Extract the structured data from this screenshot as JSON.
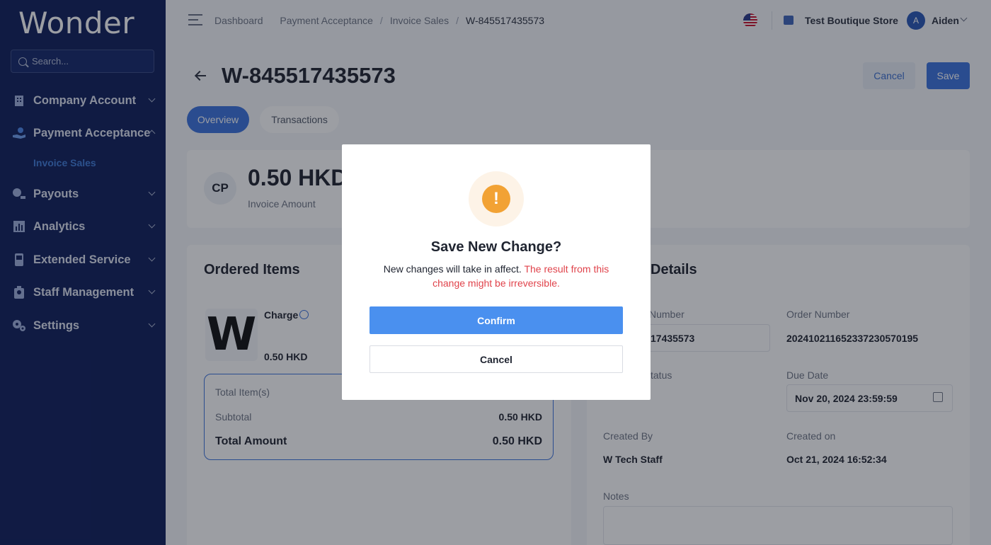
{
  "app": {
    "logo": "Wonder"
  },
  "sidebar": {
    "search_placeholder": "Search...",
    "items": [
      {
        "label": "Company Account",
        "icon": "building-icon",
        "expanded": false
      },
      {
        "label": "Payment Acceptance",
        "icon": "hand-coin-icon",
        "expanded": true
      },
      {
        "label": "Payouts",
        "icon": "money-out-icon",
        "expanded": false
      },
      {
        "label": "Analytics",
        "icon": "chart-icon",
        "expanded": false
      },
      {
        "label": "Extended Service",
        "icon": "device-icon",
        "expanded": false
      },
      {
        "label": "Staff Management",
        "icon": "staff-icon",
        "expanded": false
      },
      {
        "label": "Settings",
        "icon": "gear-icon",
        "expanded": false
      }
    ],
    "sub_item": "Invoice Sales"
  },
  "header": {
    "breadcrumbs": [
      "Dashboard",
      "Payment Acceptance",
      "Invoice Sales",
      "W-845517435573"
    ],
    "store": "Test Boutique Store",
    "avatar_initial": "A",
    "user": "Aiden"
  },
  "page": {
    "title": "W-845517435573",
    "cancel_label": "Cancel",
    "save_label": "Save",
    "tabs": [
      "Overview",
      "Transactions"
    ]
  },
  "summary": {
    "badge": "CP",
    "amount": "0.50 HKD",
    "amount_label": "Invoice Amount"
  },
  "ordered_items": {
    "title": "Ordered Items",
    "thumb": "W",
    "item_name": "Charge",
    "item_price": "0.50 HKD",
    "total_items_label": "Total Item(s)",
    "subtotal_label": "Subtotal",
    "subtotal_value": "0.50 HKD",
    "total_label": "Total Amount",
    "total_value": "0.50 HKD"
  },
  "details": {
    "title_fragment": "Details",
    "invoice_number_label": "Number",
    "invoice_number_value": "17435573",
    "order_number_label": "Order Number",
    "order_number_value": "20241021165233723057019​5",
    "status_label": "tatus",
    "due_date_label": "Due Date",
    "due_date_value": "Nov 20, 2024 23:59:59",
    "created_by_label": "Created By",
    "created_by_value": "W Tech Staff",
    "created_on_label": "Created on",
    "created_on_value": "Oct 21, 2024 16:52:34",
    "notes_label": "Notes"
  },
  "modal": {
    "icon": "!",
    "title": "Save New Change?",
    "message": "New changes will take in affect.",
    "warning": "The result from this change might be irreversible.",
    "confirm_label": "Confirm",
    "cancel_label": "Cancel"
  }
}
